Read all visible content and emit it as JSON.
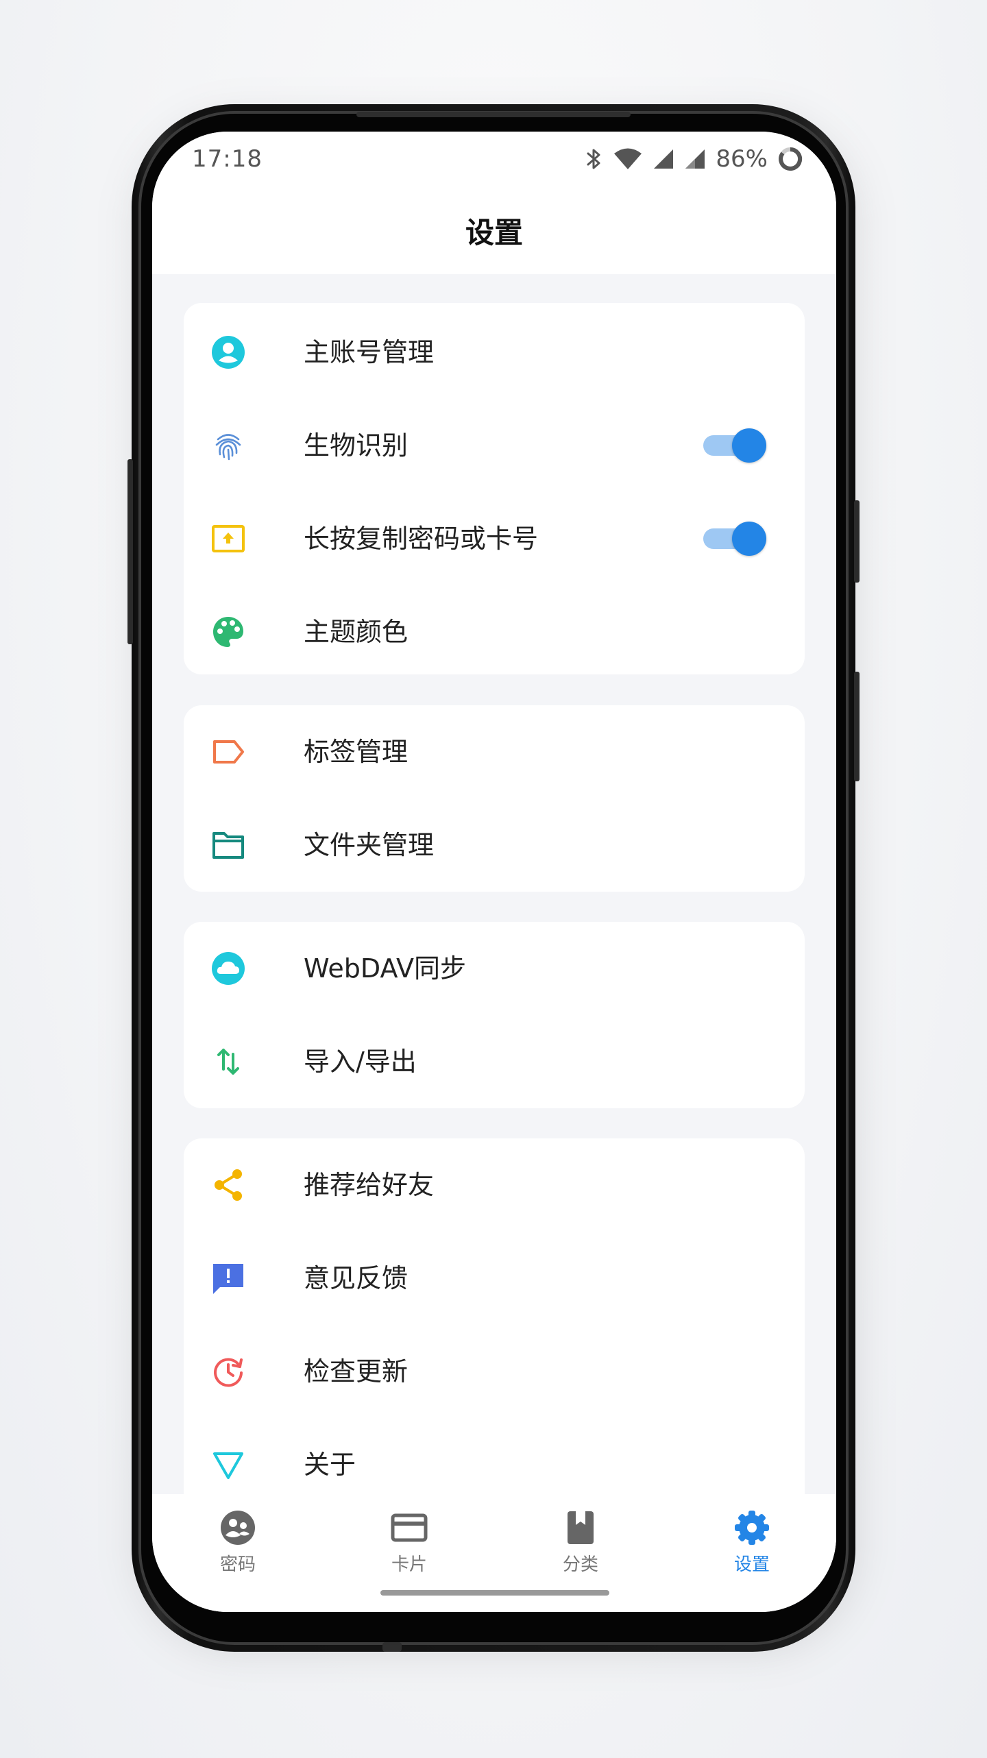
{
  "status_bar": {
    "time": "17:18",
    "battery": "86%"
  },
  "header": {
    "title": "设置"
  },
  "groups": [
    {
      "items": [
        {
          "label": "主账号管理",
          "icon": "account-circle-icon",
          "color": "#1ec8dc"
        },
        {
          "label": "生物识别",
          "icon": "fingerprint-icon",
          "color": "#5a8fd8",
          "toggle": true
        },
        {
          "label": "长按复制密码或卡号",
          "icon": "copy-upload-icon",
          "color": "#f4c20d",
          "toggle": true
        },
        {
          "label": "主题颜色",
          "icon": "palette-icon",
          "color": "#2eb872"
        }
      ]
    },
    {
      "items": [
        {
          "label": "标签管理",
          "icon": "label-tag-icon",
          "color": "#f0784a"
        },
        {
          "label": "文件夹管理",
          "icon": "folder-icon",
          "color": "#15897e"
        }
      ]
    },
    {
      "items": [
        {
          "label": "WebDAV同步",
          "icon": "cloud-icon",
          "color": "#1ec8dc"
        },
        {
          "label": "导入/导出",
          "icon": "import-export-icon",
          "color": "#2eb872"
        }
      ]
    },
    {
      "items": [
        {
          "label": "推荐给好友",
          "icon": "share-icon",
          "color": "#f4b400"
        },
        {
          "label": "意见反馈",
          "icon": "feedback-icon",
          "color": "#4b70e2"
        },
        {
          "label": "检查更新",
          "icon": "update-icon",
          "color": "#f05a5a"
        },
        {
          "label": "关于",
          "icon": "about-triangle-icon",
          "color": "#1ec8dc"
        }
      ]
    }
  ],
  "bottom_nav": [
    {
      "label": "密码",
      "icon": "password-group-icon"
    },
    {
      "label": "卡片",
      "icon": "card-icon"
    },
    {
      "label": "分类",
      "icon": "category-book-icon"
    },
    {
      "label": "设置",
      "icon": "settings-gear-icon",
      "active": true
    }
  ],
  "colors": {
    "accent": "#2385e6",
    "toggle_track": "#9ec8f3",
    "inactive_nav": "#777777",
    "background": "#f4f5f8"
  }
}
